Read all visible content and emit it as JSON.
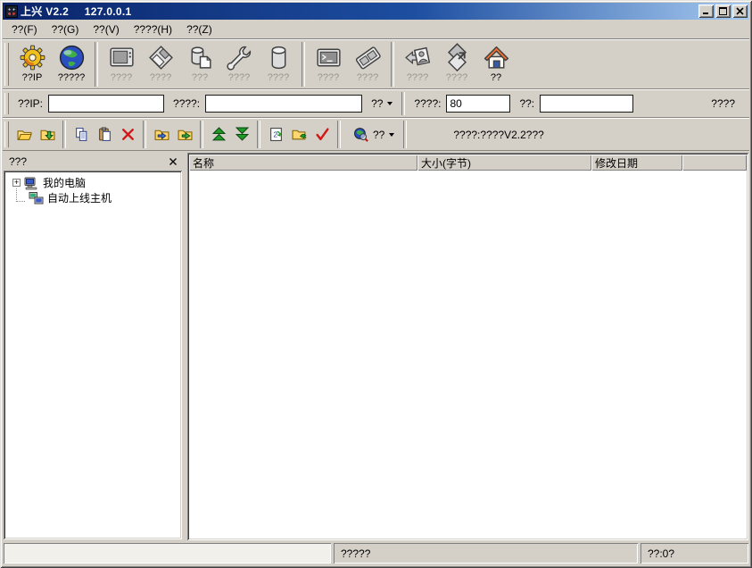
{
  "window": {
    "title_app": "上兴 V2.2",
    "title_ip": "127.0.0.1"
  },
  "menu": {
    "items": [
      {
        "label": "??(F)"
      },
      {
        "label": "??(G)"
      },
      {
        "label": "??(V)"
      },
      {
        "label": "????(H)"
      },
      {
        "label": "??(Z)"
      }
    ]
  },
  "toolbar_main": {
    "buttons": [
      {
        "label": "??IP",
        "icon": "gear-icon",
        "enabled": true
      },
      {
        "label": "?????",
        "icon": "globe-icon",
        "enabled": true
      },
      {
        "label": "????",
        "icon": "monitor-icon",
        "enabled": false
      },
      {
        "label": "????",
        "icon": "disk-icon",
        "enabled": false
      },
      {
        "label": "???",
        "icon": "drive-page-icon",
        "enabled": false
      },
      {
        "label": "????",
        "icon": "wrench-icon",
        "enabled": false
      },
      {
        "label": "????",
        "icon": "database-icon",
        "enabled": false
      },
      {
        "label": "????",
        "icon": "terminal-icon",
        "enabled": false
      },
      {
        "label": "????",
        "icon": "keyboard-icon",
        "enabled": false
      },
      {
        "label": "????",
        "icon": "user-card-icon",
        "enabled": false
      },
      {
        "label": "????",
        "icon": "windows-arrow-icon",
        "enabled": false
      },
      {
        "label": "??",
        "icon": "home-icon",
        "enabled": true
      }
    ]
  },
  "address_bar": {
    "ip_label": "??IP:",
    "ip_value": "",
    "url_label": "????:",
    "url_value": "",
    "connect_label": "??",
    "port_label": "????:",
    "port_value": "80",
    "password_label": "??:",
    "password_value": "",
    "action_label": "????"
  },
  "file_toolbar": {
    "buttons": [
      {
        "icon": "folder-open-icon"
      },
      {
        "icon": "folder-up-icon"
      },
      {
        "icon": "copy-icon"
      },
      {
        "icon": "paste-icon"
      },
      {
        "icon": "delete-icon"
      },
      {
        "icon": "folder-in-icon"
      },
      {
        "icon": "folder-right-icon"
      },
      {
        "icon": "upload-icon"
      },
      {
        "icon": "download-icon"
      },
      {
        "icon": "refresh-icon"
      },
      {
        "icon": "folder-go-icon"
      },
      {
        "icon": "check-icon"
      }
    ],
    "search_label": "??",
    "transfer_status": "????:????V2.2???"
  },
  "sidebar": {
    "header": "???",
    "tree": [
      {
        "label": "我的电脑",
        "expand": "+",
        "icon": "my-computer-icon"
      },
      {
        "label": "自动上线主机",
        "icon": "online-hosts-icon"
      }
    ]
  },
  "file_list": {
    "columns": [
      "名称",
      "大小(字节)",
      "修改日期",
      ""
    ]
  },
  "status_bar": {
    "message": "?????",
    "count": "??:0?"
  }
}
